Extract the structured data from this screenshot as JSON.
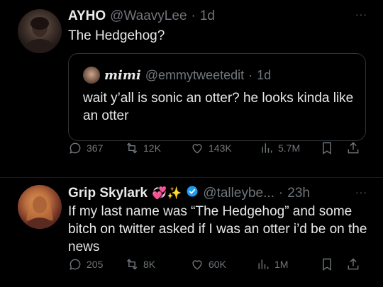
{
  "tweets": [
    {
      "author_name": "AYHO",
      "author_handle": "@WaavyLee",
      "separator": "·",
      "time": "1d",
      "text": "The Hedgehog?",
      "quote": {
        "author_name": "𝒎𝒊𝒎𝒊",
        "author_handle": "@emmytweetedit",
        "separator": "·",
        "time": "1d",
        "text": "wait y’all is sonic an otter? he looks kinda like an otter"
      },
      "metrics": {
        "replies": "367",
        "reposts": "12K",
        "likes": "143K",
        "views": "5.7M"
      },
      "more_label": "···"
    },
    {
      "author_name": "Grip Skylark",
      "name_emojis": "💞✨",
      "author_handle": "@talleybe...",
      "separator": "·",
      "time": "23h",
      "text": "If my last name was “The Hedgehog” and some bitch on twitter asked if I was an otter i’d be on the news",
      "metrics": {
        "replies": "205",
        "reposts": "8K",
        "likes": "60K",
        "views": "1M"
      },
      "more_label": "···"
    }
  ],
  "colors": {
    "background": "#000000",
    "text": "#e7e9ea",
    "muted": "#71767b",
    "verified": "#1d9bf0",
    "border": "#2f3336"
  },
  "icons": [
    "reply-icon",
    "repost-icon",
    "like-icon",
    "views-icon",
    "bookmark-icon",
    "share-icon",
    "verified-badge-icon",
    "more-icon"
  ]
}
